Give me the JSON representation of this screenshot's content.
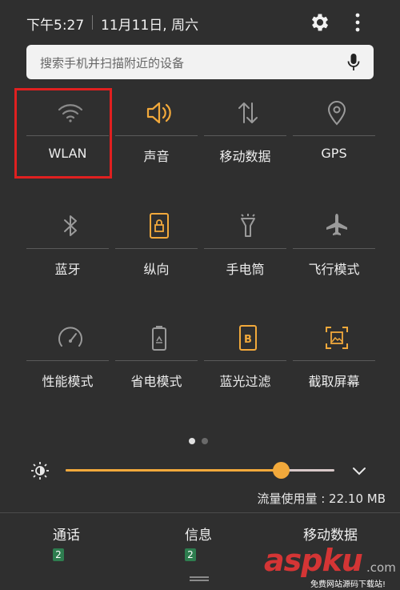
{
  "status": {
    "time": "下午5:27",
    "date": "11月11日, 周六"
  },
  "search": {
    "placeholder": "搜索手机并扫描附近的设备"
  },
  "tiles": [
    {
      "label": "WLAN",
      "icon": "wifi-icon",
      "active": false
    },
    {
      "label": "声音",
      "icon": "volume-icon",
      "active": true
    },
    {
      "label": "移动数据",
      "icon": "mobile-data-icon",
      "active": false
    },
    {
      "label": "GPS",
      "icon": "location-icon",
      "active": false
    },
    {
      "label": "蓝牙",
      "icon": "bluetooth-icon",
      "active": false
    },
    {
      "label": "纵向",
      "icon": "portrait-lock-icon",
      "active": true
    },
    {
      "label": "手电筒",
      "icon": "flashlight-icon",
      "active": false
    },
    {
      "label": "飞行模式",
      "icon": "airplane-icon",
      "active": false
    },
    {
      "label": "性能模式",
      "icon": "speedometer-icon",
      "active": false
    },
    {
      "label": "省电模式",
      "icon": "battery-saver-icon",
      "active": false
    },
    {
      "label": "蓝光过滤",
      "icon": "blue-light-filter-icon",
      "active": true
    },
    {
      "label": "截取屏幕",
      "icon": "screenshot-icon",
      "active": true
    }
  ],
  "pager": {
    "current": 1,
    "total": 2
  },
  "brightness": {
    "level": 0.8
  },
  "data_usage": "流量使用量 : 22.10 MB",
  "sims": [
    {
      "label": "通话",
      "slot": "2"
    },
    {
      "label": "信息",
      "slot": "2"
    },
    {
      "label": "移动数据",
      "slot": ""
    }
  ],
  "watermark": {
    "brand": "aspku",
    "suffix": ".com",
    "tagline": "免费网站源码下载站!"
  },
  "colors": {
    "background": "#2f2f2f",
    "active": "#f2a93b",
    "inactive": "#9a9a9a",
    "highlight": "#e02020",
    "sim_badge": "#2e7d4f"
  }
}
